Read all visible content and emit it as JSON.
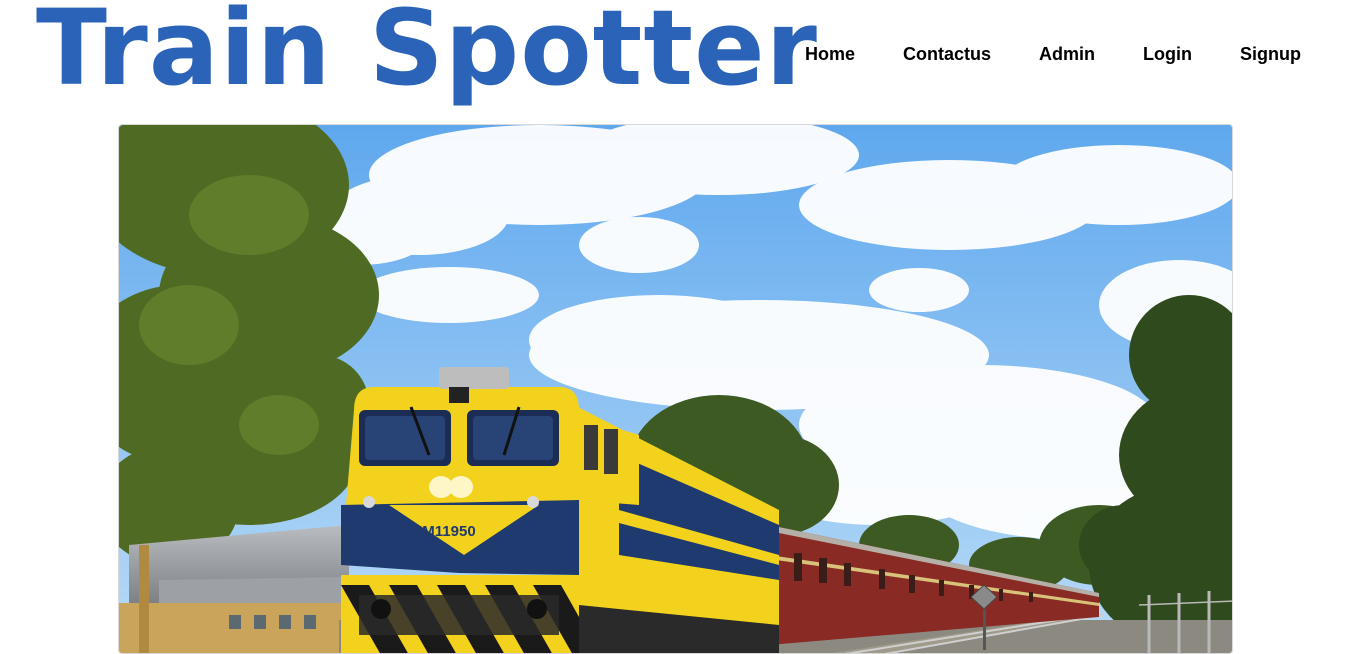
{
  "brand": {
    "title": "Train Spotter",
    "color": "#2a63b8"
  },
  "nav": {
    "items": [
      {
        "label": "Home"
      },
      {
        "label": "Contactus"
      },
      {
        "label": "Admin"
      },
      {
        "label": "Login"
      },
      {
        "label": "Signup"
      }
    ]
  },
  "hero": {
    "locomotive_number": "M11950",
    "colors": {
      "sky_top": "#5fa8ee",
      "sky_bottom": "#a9d2f6",
      "locomotive_yellow": "#f2d21c",
      "locomotive_blue": "#1e3a6e",
      "coach_red": "#8a2a24",
      "foliage": "#4f6a22"
    }
  }
}
